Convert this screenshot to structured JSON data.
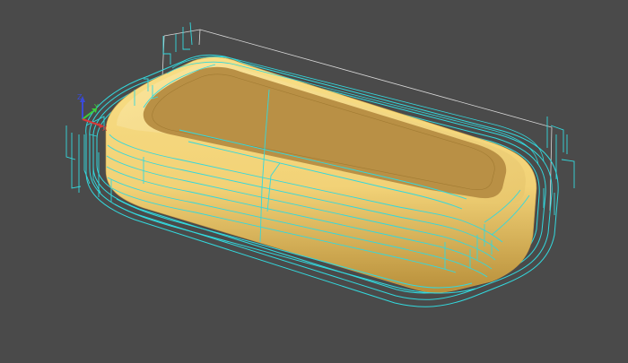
{
  "viewport": {
    "background": "#4a4a4a",
    "label": "3D view"
  },
  "colors": {
    "part_light": "#f8de85",
    "part_mid": "#e2bf62",
    "part_dark": "#b88f3a",
    "top_face": "#b99045",
    "toolpath": "#33d8dd",
    "bounds_box": "#d8d8d8",
    "axis_x": "#d83a3a",
    "axis_y": "#3ad03a",
    "axis_z": "#3a4ad8"
  },
  "triad": {
    "x_label": "X",
    "y_label": "Y",
    "z_label": "Z"
  }
}
